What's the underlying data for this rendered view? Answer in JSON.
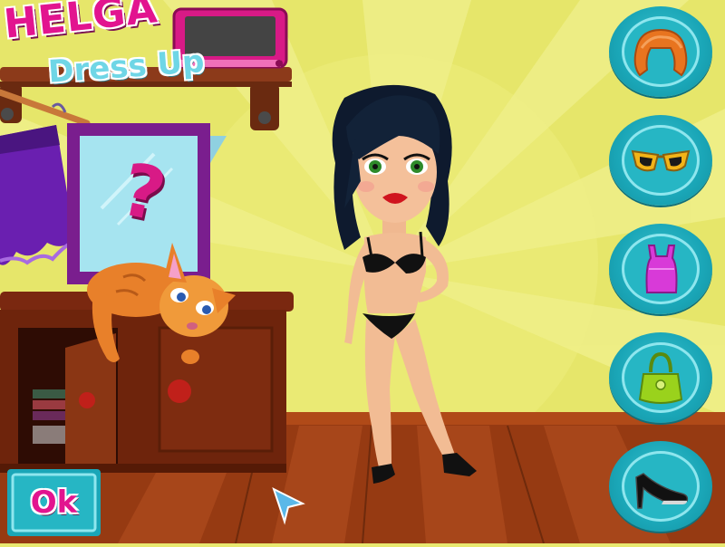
{
  "game": {
    "title_line1": "HELGA",
    "title_line2": "Dress Up"
  },
  "mystery_frame": {
    "symbol": "?"
  },
  "categories": [
    {
      "id": "hair",
      "icon": "hair-wig-icon",
      "color": "#e8741f"
    },
    {
      "id": "glasses",
      "icon": "sunglasses-icon",
      "color": "#f2b418"
    },
    {
      "id": "tops",
      "icon": "tank-top-icon",
      "color": "#d83ad8"
    },
    {
      "id": "bags",
      "icon": "handbag-icon",
      "color": "#9ad21c"
    },
    {
      "id": "shoes",
      "icon": "high-heel-shoe-icon",
      "color": "#111111"
    }
  ],
  "ok_button": {
    "label": "Ok"
  },
  "colors": {
    "wall": "#e8e870",
    "floor": "#9a3c14",
    "button_teal": "#1aa6b7",
    "title_pink": "#e2148f",
    "title_cyan": "#6fd6e6"
  }
}
